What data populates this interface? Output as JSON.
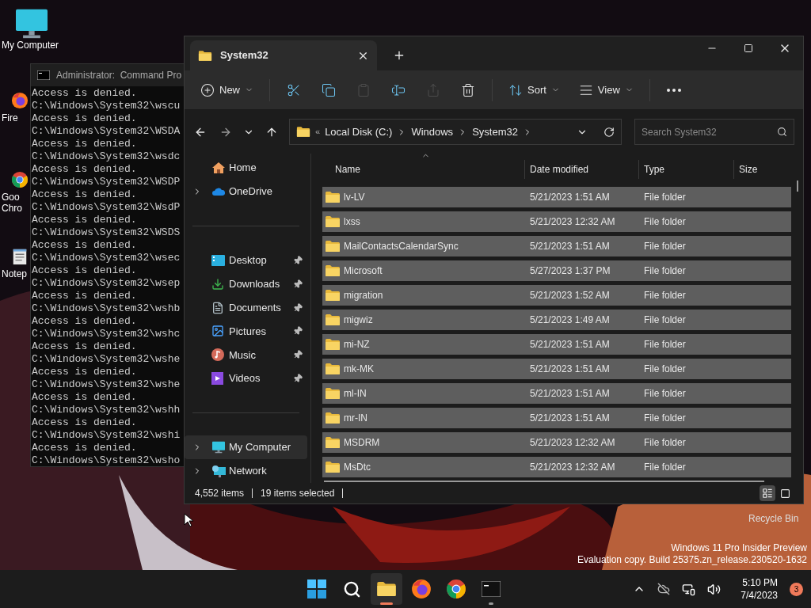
{
  "desktop": {
    "icons": [
      {
        "kind": "computer",
        "lines": [
          "My Computer"
        ]
      },
      {
        "kind": "firefox",
        "lines": [
          "Fire"
        ]
      },
      {
        "kind": "chrome",
        "lines": [
          "Goo",
          "Chro"
        ]
      },
      {
        "kind": "notepad",
        "lines": [
          "Notep"
        ]
      }
    ],
    "recycle_bin": "Recycle Bin",
    "watermark": [
      "Windows 11 Pro Insider Preview",
      "Evaluation copy. Build 25375.zn_release.230520-1632"
    ]
  },
  "cmd": {
    "title": "Administrator:  Command Pro",
    "lines": [
      "Access is denied.",
      "C:\\Windows\\System32\\wscu",
      "Access is denied.",
      "C:\\Windows\\System32\\WSDA",
      "Access is denied.",
      "C:\\Windows\\System32\\wsdc",
      "Access is denied.",
      "C:\\Windows\\System32\\WSDP",
      "Access is denied.",
      "C:\\Windows\\System32\\WsdP",
      "Access is denied.",
      "C:\\Windows\\System32\\WSDS",
      "Access is denied.",
      "C:\\Windows\\System32\\wsec",
      "Access is denied.",
      "C:\\Windows\\System32\\wsep",
      "Access is denied.",
      "C:\\Windows\\System32\\wshb",
      "Access is denied.",
      "C:\\Windows\\System32\\wshc",
      "Access is denied.",
      "C:\\Windows\\System32\\wshe",
      "Access is denied.",
      "C:\\Windows\\System32\\wshe",
      "Access is denied.",
      "C:\\Windows\\System32\\wshh",
      "Access is denied.",
      "C:\\Windows\\System32\\wshi",
      "Access is denied.",
      "C:\\Windows\\System32\\wsho"
    ]
  },
  "explorer": {
    "tabs": [
      {
        "label": "System32",
        "selected": true
      }
    ],
    "toolbar": [
      {
        "kind": "new",
        "label": "New",
        "disabled": false
      },
      {
        "kind": "cut",
        "disabled": false
      },
      {
        "kind": "copy",
        "disabled": false
      },
      {
        "kind": "paste",
        "disabled": true
      },
      {
        "kind": "rename",
        "disabled": false
      },
      {
        "kind": "share",
        "disabled": true
      },
      {
        "kind": "delete",
        "disabled": false
      },
      {
        "kind": "sort",
        "label": "Sort",
        "disabled": false
      },
      {
        "kind": "view",
        "label": "View",
        "disabled": false
      },
      {
        "kind": "more",
        "disabled": false
      }
    ],
    "overflow": "«",
    "breadcrumb": [
      "Local Disk (C:)",
      "Windows",
      "System32"
    ],
    "search": {
      "placeholder": "Search System32"
    },
    "sidebar": [
      {
        "kind": "home",
        "label": "Home",
        "expandable": false,
        "pinned": false,
        "selected": false
      },
      {
        "kind": "onedrive",
        "label": "OneDrive",
        "expandable": true,
        "pinned": false,
        "selected": false
      },
      {
        "kind": "divider"
      },
      {
        "kind": "desktop",
        "label": "Desktop",
        "expandable": false,
        "pinned": true,
        "selected": false
      },
      {
        "kind": "downloads",
        "label": "Downloads",
        "expandable": false,
        "pinned": true,
        "selected": false
      },
      {
        "kind": "documents",
        "label": "Documents",
        "expandable": false,
        "pinned": true,
        "selected": false
      },
      {
        "kind": "pictures",
        "label": "Pictures",
        "expandable": false,
        "pinned": true,
        "selected": false
      },
      {
        "kind": "music",
        "label": "Music",
        "expandable": false,
        "pinned": true,
        "selected": false
      },
      {
        "kind": "videos",
        "label": "Videos",
        "expandable": false,
        "pinned": true,
        "selected": false
      },
      {
        "kind": "divider"
      },
      {
        "kind": "computer",
        "label": "My Computer",
        "expandable": true,
        "pinned": false,
        "selected": true
      },
      {
        "kind": "network",
        "label": "Network",
        "expandable": true,
        "pinned": false,
        "selected": false
      }
    ],
    "columns": [
      "Name",
      "Date modified",
      "Type",
      "Size"
    ],
    "rows": [
      {
        "name": "lv-LV",
        "date": "5/21/2023 1:51 AM",
        "type": "File folder",
        "selected": true
      },
      {
        "name": "lxss",
        "date": "5/21/2023 12:32 AM",
        "type": "File folder",
        "selected": true
      },
      {
        "name": "MailContactsCalendarSync",
        "date": "5/21/2023 1:51 AM",
        "type": "File folder",
        "selected": true
      },
      {
        "name": "Microsoft",
        "date": "5/27/2023 1:37 PM",
        "type": "File folder",
        "selected": true
      },
      {
        "name": "migration",
        "date": "5/21/2023 1:52 AM",
        "type": "File folder",
        "selected": true
      },
      {
        "name": "migwiz",
        "date": "5/21/2023 1:49 AM",
        "type": "File folder",
        "selected": true
      },
      {
        "name": "mi-NZ",
        "date": "5/21/2023 1:51 AM",
        "type": "File folder",
        "selected": true
      },
      {
        "name": "mk-MK",
        "date": "5/21/2023 1:51 AM",
        "type": "File folder",
        "selected": true
      },
      {
        "name": "ml-IN",
        "date": "5/21/2023 1:51 AM",
        "type": "File folder",
        "selected": true
      },
      {
        "name": "mr-IN",
        "date": "5/21/2023 1:51 AM",
        "type": "File folder",
        "selected": true
      },
      {
        "name": "MSDRM",
        "date": "5/21/2023 12:32 AM",
        "type": "File folder",
        "selected": true
      },
      {
        "name": "MsDtc",
        "date": "5/21/2023 12:32 AM",
        "type": "File folder",
        "selected": true
      }
    ],
    "status": {
      "count": "4,552 items",
      "selected": "19 items selected"
    },
    "view_modes": [
      {
        "kind": "details",
        "selected": true
      },
      {
        "kind": "tiles",
        "selected": false
      }
    ]
  },
  "taskbar": {
    "apps": [
      {
        "kind": "start",
        "selected": false,
        "running": false
      },
      {
        "kind": "search",
        "selected": false,
        "running": false
      },
      {
        "kind": "explorer",
        "selected": true,
        "running": true
      },
      {
        "kind": "firefox",
        "selected": false,
        "running": false
      },
      {
        "kind": "chrome",
        "selected": false,
        "running": false
      },
      {
        "kind": "terminal",
        "selected": false,
        "running": true
      }
    ],
    "time": "5:10 PM",
    "date": "7/4/2023",
    "notifications": "3"
  }
}
